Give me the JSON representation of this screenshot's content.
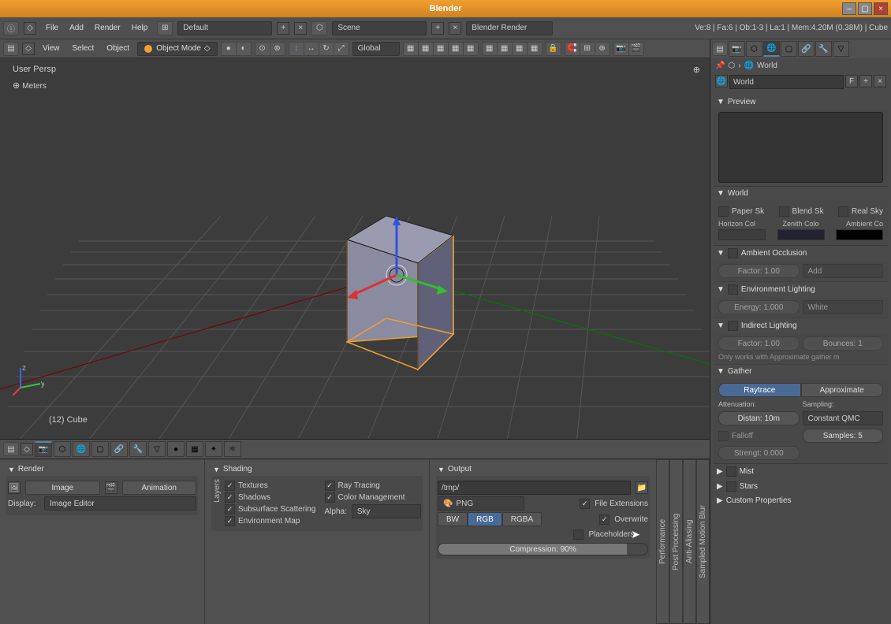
{
  "title": "Blender",
  "topmenu": [
    "File",
    "Add",
    "Render",
    "Help"
  ],
  "layout_dropdown": "Default",
  "scene_dropdown": "Scene",
  "renderer_dropdown": "Blender Render",
  "stats": "Ve:8 | Fa:6 | Ob:1-3 | La:1 | Mem:4.20M (0.38M) | Cube",
  "view_menu": [
    "View",
    "Select",
    "Object"
  ],
  "mode": "Object Mode",
  "orientation": "Global",
  "viewport_label": "User Persp",
  "viewport_meters": "Meters",
  "obj_label": "(12) Cube",
  "render_panel": {
    "title": "Render",
    "image_btn": "Image",
    "anim_btn": "Animation",
    "display_label": "Display:",
    "display_value": "Image Editor"
  },
  "shading_panel": {
    "title": "Shading",
    "layers_label": "Layers",
    "cb1": "Textures",
    "cb2": "Shadows",
    "cb3": "Subsurface Scattering",
    "cb4": "Environment Map",
    "cb5": "Ray Tracing",
    "cb6": "Color Management",
    "alpha_label": "Alpha:",
    "alpha_value": "Sky"
  },
  "output_panel": {
    "title": "Output",
    "path": "/tmp/",
    "format": "PNG",
    "bw": "BW",
    "rgb": "RGB",
    "rgba": "RGBA",
    "cb1": "File Extensions",
    "cb2": "Overwrite",
    "cb3": "Placeholders",
    "compression_label": "Compression: 90%"
  },
  "vtabs": [
    "Performance",
    "Post Processing",
    "Anti-Aliasing",
    "Sampled Motion Blur"
  ],
  "right": {
    "breadcrumb": "World",
    "name": "World",
    "preview_title": "Preview",
    "world_title": "World",
    "world_cb1": "Paper Sk",
    "world_cb2": "Blend Sk",
    "world_cb3": "Real Sky",
    "horizon": "Horizon Col",
    "zenith": "Zenith Colo",
    "ambient": "Ambient Co",
    "ao_title": "Ambient Occlusion",
    "ao_factor": "Factor: 1.00",
    "ao_mode": "Add",
    "env_title": "Environment Lighting",
    "env_energy": "Energy: 1.000",
    "env_color": "White",
    "ind_title": "Indirect Lighting",
    "ind_factor": "Factor: 1.00",
    "ind_bounces": "Bounces: 1",
    "ind_note": "Only works with Approximate gather m",
    "gather_title": "Gather",
    "gather_ray": "Raytrace",
    "gather_approx": "Approximate",
    "atten_label": "Attenuation:",
    "samp_label": "Sampling:",
    "distance": "Distan: 10m",
    "qmc": "Constant QMC",
    "falloff": "Falloff",
    "samples": "Samples: 5",
    "strength": "Strengt: 0.000",
    "mist": "Mist",
    "stars": "Stars",
    "custom": "Custom Properties"
  }
}
